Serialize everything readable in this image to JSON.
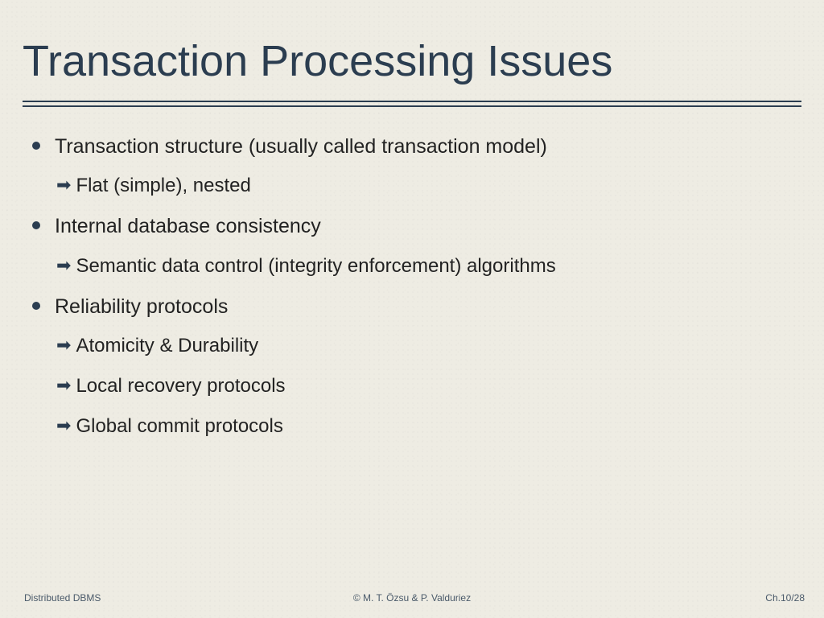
{
  "title": "Transaction Processing Issues",
  "bullets": [
    {
      "text": "Transaction structure (usually called transaction model)",
      "subs": [
        "Flat (simple), nested"
      ]
    },
    {
      "text": "Internal database consistency",
      "subs": [
        "Semantic data control (integrity enforcement) algorithms"
      ]
    },
    {
      "text": "Reliability protocols",
      "subs": [
        "Atomicity & Durability",
        "Local recovery protocols",
        "Global commit protocols"
      ]
    }
  ],
  "footer": {
    "left": "Distributed DBMS",
    "center": "© M. T. Özsu & P. Valduriez",
    "right": "Ch.10/28"
  }
}
